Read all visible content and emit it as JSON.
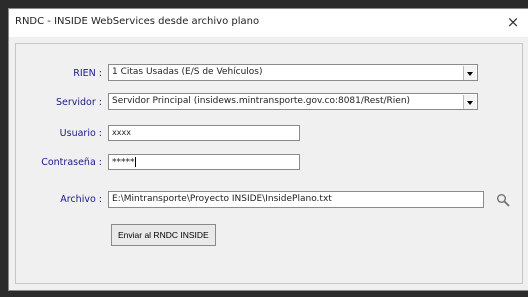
{
  "window": {
    "title": "RNDC - INSIDE  WebServices desde archivo plano",
    "close_glyph": "×"
  },
  "form": {
    "rien_label": "RIEN :",
    "rien_value": "1 Citas Usadas (E/S de Vehículos)",
    "servidor_label": "Servidor :",
    "servidor_value": "Servidor Principal (insidews.mintransporte.gov.co:8081/Rest/Rien)",
    "usuario_label": "Usuario :",
    "usuario_value": "xxxx",
    "password_label": "Contraseña :",
    "password_value": "*****",
    "archivo_label": "Archivo :",
    "archivo_value": "E:\\Mintransporte\\Proyecto INSIDE\\InsidePlano.txt",
    "submit_label": "Enviar al RNDC INSIDE"
  },
  "icons": {
    "search": "magnifier-icon",
    "dropdown": "chevron-down-icon",
    "close": "close-icon"
  }
}
